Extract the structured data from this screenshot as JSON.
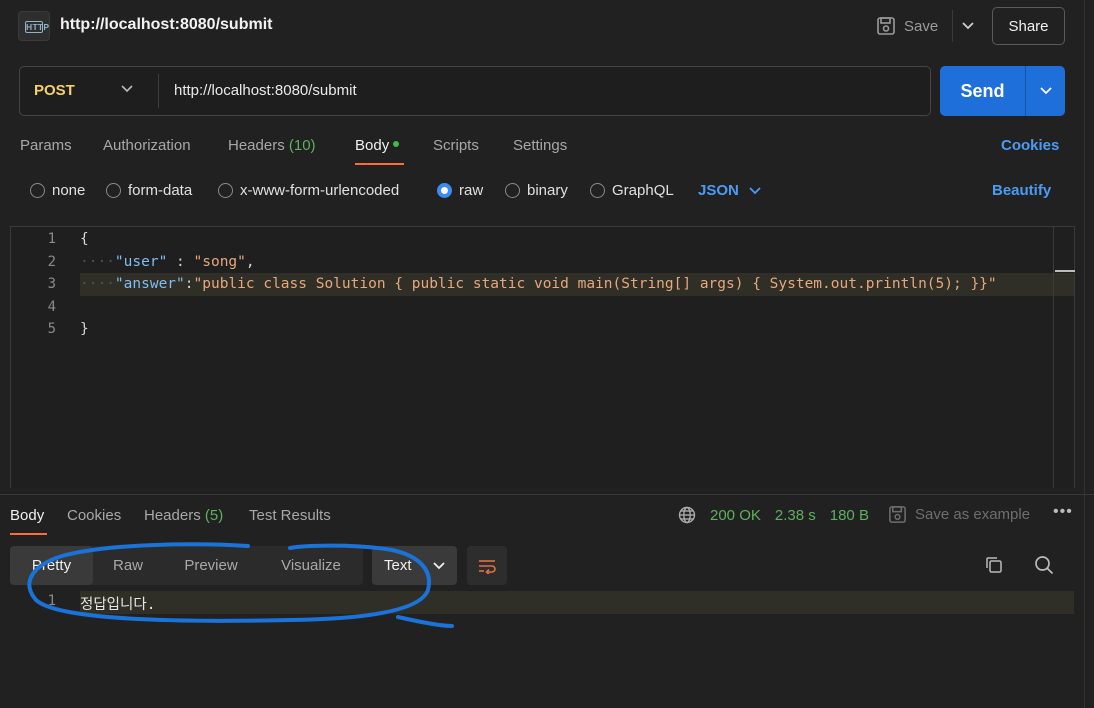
{
  "header": {
    "icon_label": "HTTP",
    "title": "http://localhost:8080/submit",
    "save_label": "Save",
    "share_label": "Share"
  },
  "request": {
    "method": "POST",
    "url": "http://localhost:8080/submit",
    "send_label": "Send",
    "tabs": [
      {
        "label": "Params"
      },
      {
        "label": "Authorization"
      },
      {
        "label": "Headers",
        "count": "(10)"
      },
      {
        "label": "Body"
      },
      {
        "label": "Scripts"
      },
      {
        "label": "Settings"
      }
    ],
    "active_tab": "Body",
    "cookies_label": "Cookies",
    "body_types": [
      "none",
      "form-data",
      "x-www-form-urlencoded",
      "raw",
      "binary",
      "GraphQL"
    ],
    "selected_body_type": "raw",
    "format": "JSON",
    "beautify_label": "Beautify",
    "editor": {
      "line_numbers": [
        "1",
        "2",
        "3",
        "4",
        "5"
      ],
      "line1": "{",
      "line2_key": "\"user\"",
      "line2_sep": " : ",
      "line2_val": "\"song\"",
      "line2_end": ",",
      "line3_key": "\"answer\"",
      "line3_sep": ":",
      "line3_val": "\"public class Solution { public static void main(String[] args) { System.out.println(5); }}\"",
      "line5": "}"
    }
  },
  "response": {
    "tabs": [
      {
        "label": "Body"
      },
      {
        "label": "Cookies"
      },
      {
        "label": "Headers",
        "count": "(5)"
      },
      {
        "label": "Test Results"
      }
    ],
    "status": "200 OK",
    "time": "2.38 s",
    "size": "180 B",
    "save_example_label": "Save as example",
    "view_modes": [
      "Pretty",
      "Raw",
      "Preview",
      "Visualize"
    ],
    "active_view_mode": "Pretty",
    "content_type": "Text",
    "line_number": "1",
    "body_text": "정답입니다."
  },
  "colors": {
    "accent": "#ff6c37",
    "send": "#1e6fd9",
    "link": "#4b9bf5",
    "success": "#5fb05f",
    "method_post": "#f4d16b",
    "annotation": "#1a73d9"
  }
}
